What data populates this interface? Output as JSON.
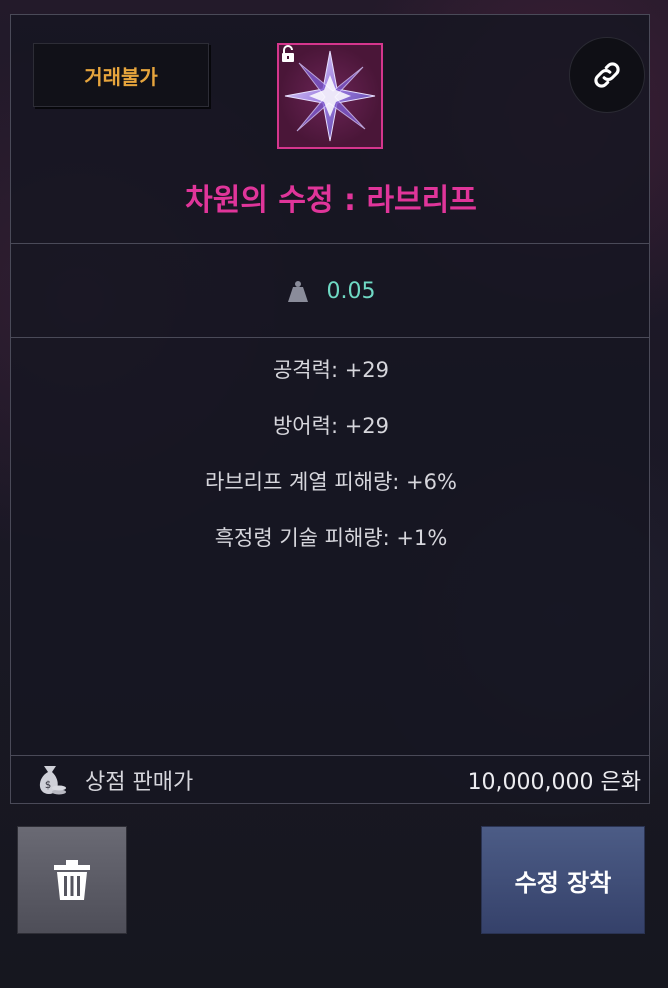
{
  "trade_badge": {
    "label": "거래불가"
  },
  "item": {
    "name": "차원의 수정 : 라브리프",
    "icon": "purple-crystal-icon",
    "lock_icon": "unlocked-padlock-icon",
    "name_color": "#e0359a",
    "border_color": "#d5368d"
  },
  "link_button": {
    "icon": "chain-link-icon"
  },
  "weight": {
    "icon": "weight-icon",
    "value": "0.05",
    "color": "#6fd9c4"
  },
  "stats": [
    "공격력: +29",
    "방어력: +29",
    "라브리프 계열 피해량: +6%",
    "흑정령 기술 피해량: +1%"
  ],
  "shop_sell": {
    "icon": "money-bag-icon",
    "label": "상점 판매가",
    "price": "10,000,000 은화"
  },
  "actions": {
    "delete_icon": "trash-icon",
    "equip_label": "수정 장착"
  }
}
